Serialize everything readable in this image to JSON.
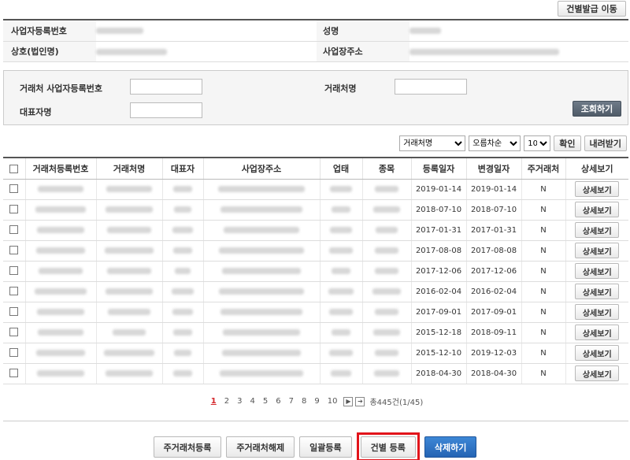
{
  "top_button": "건별발급 이동",
  "info": {
    "biz_no_label": "사업자등록번호",
    "name_label": "성명",
    "company_label": "상호(법인명)",
    "address_label": "사업장주소"
  },
  "search": {
    "partner_biz_no_label": "거래처 사업자등록번호",
    "partner_name_label": "거래처명",
    "ceo_label": "대표자명",
    "search_button": "조회하기"
  },
  "tools": {
    "sort_field": "거래처명",
    "sort_order": "오름차순",
    "page_size": "10",
    "confirm_button": "확인",
    "download_button": "내려받기"
  },
  "grid": {
    "headers": [
      "거래처등록번호",
      "거래처명",
      "대표자",
      "사업장주소",
      "업태",
      "종목",
      "등록일자",
      "변경일자",
      "주거래처",
      "상세보기"
    ],
    "detail_label": "상세보기",
    "rows": [
      {
        "reg": "2019-01-14",
        "mod": "2019-01-14",
        "main": "N"
      },
      {
        "reg": "2018-07-10",
        "mod": "2018-07-10",
        "main": "N"
      },
      {
        "reg": "2017-01-31",
        "mod": "2017-01-31",
        "main": "N"
      },
      {
        "reg": "2017-08-08",
        "mod": "2017-08-08",
        "main": "N"
      },
      {
        "reg": "2017-12-06",
        "mod": "2017-12-06",
        "main": "N"
      },
      {
        "reg": "2016-02-04",
        "mod": "2016-02-04",
        "main": "N"
      },
      {
        "reg": "2017-09-01",
        "mod": "2017-09-01",
        "main": "N"
      },
      {
        "reg": "2015-12-18",
        "mod": "2018-09-11",
        "main": "N"
      },
      {
        "reg": "2015-12-10",
        "mod": "2019-12-03",
        "main": "N"
      },
      {
        "reg": "2018-04-30",
        "mod": "2018-04-30",
        "main": "N"
      }
    ]
  },
  "pager": {
    "pages": [
      "1",
      "2",
      "3",
      "4",
      "5",
      "6",
      "7",
      "8",
      "9",
      "10"
    ],
    "current": "1",
    "next": "▶",
    "last": "➔",
    "total": "총445건(1/45)"
  },
  "actions": {
    "main_register": "주거래처등록",
    "main_release": "주거래처해제",
    "bulk_register": "일괄등록",
    "single_register": "건별 등록",
    "delete": "삭제하기"
  },
  "colors": {
    "highlight": "#e2141b",
    "delete_button": "#2564b4",
    "search_button": "#5a6673",
    "current_page": "#d4252a"
  }
}
